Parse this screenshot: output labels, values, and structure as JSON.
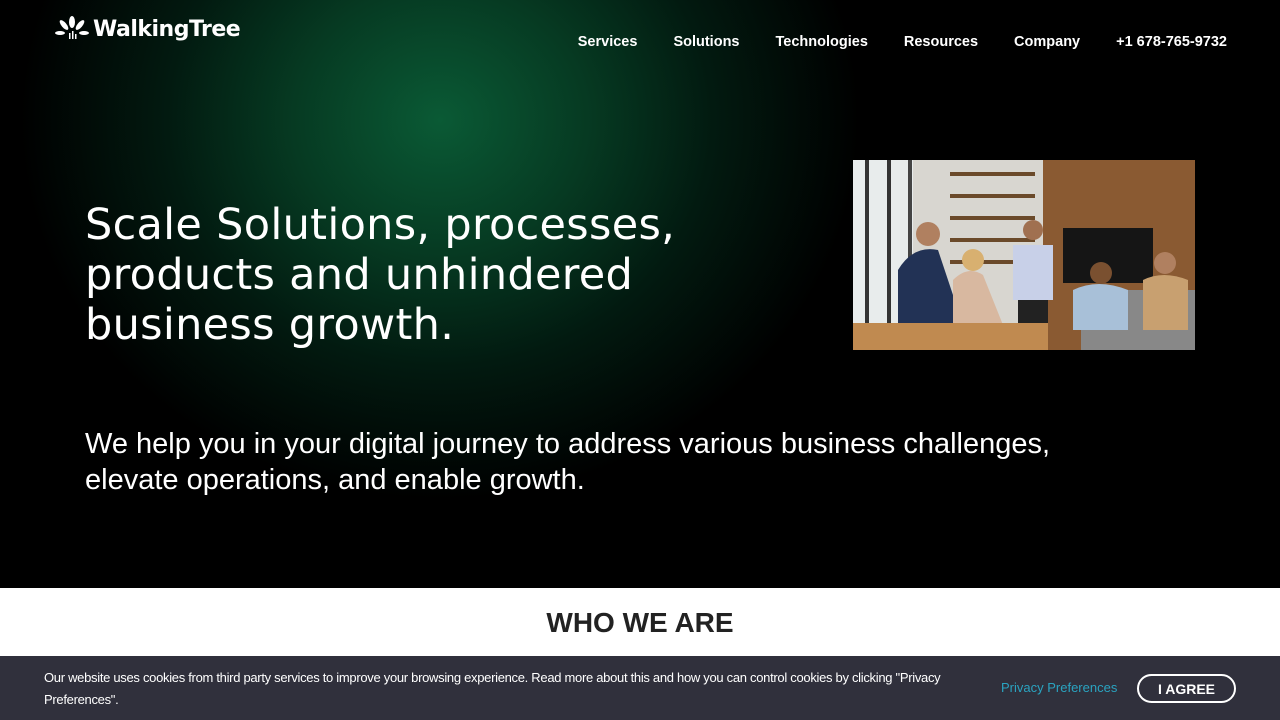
{
  "header": {
    "logo_text": "WalkingTree",
    "nav": [
      "Services",
      "Solutions",
      "Technologies",
      "Resources",
      "Company",
      "+1 678-765-9732"
    ]
  },
  "hero": {
    "headline": "Scale Solutions, processes, products and unhindered business growth.",
    "subheading": "We help you in your digital journey to address various business challenges, elevate operations, and enable growth.",
    "image_icon": "team-meeting-photo"
  },
  "section": {
    "title": "WHO WE ARE"
  },
  "cookie_banner": {
    "text": "Our website uses cookies from third party services to improve your browsing experience. Read more about this and how you can control cookies by clicking \"Privacy Preferences\".",
    "privacy_link": "Privacy Preferences",
    "agree_label": "I AGREE"
  },
  "colors": {
    "hero_green": "#0a5a35",
    "link": "#2aa3c0",
    "banner": "#28283a"
  }
}
